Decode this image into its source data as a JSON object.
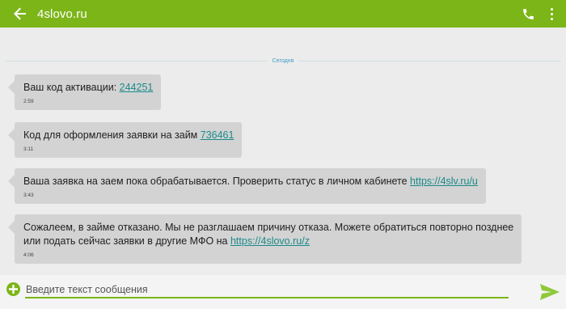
{
  "header": {
    "title": "4slovo.ru",
    "back_icon": "arrow-left-icon",
    "call_icon": "phone-icon",
    "menu_icon": "more-vertical-icon",
    "color": "#7cb518"
  },
  "date_separator": "Сегодня",
  "messages": [
    {
      "text": "Ваш код активации: ",
      "link": "244251",
      "text_after": "",
      "time": "2:59"
    },
    {
      "text": "Код для оформления заявки на займ ",
      "link": "736461",
      "text_after": "",
      "time": "3:11"
    },
    {
      "text": "Ваша заявка на заем пока обрабатывается. Проверить статус в личном кабинете ",
      "link": "https://4slv.ru/u",
      "text_after": "",
      "time": "3:43"
    },
    {
      "text_line1": "Сожалеем, в займе отказано. Мы не разглашаем причину отказа. Можете обратиться повторно позднее",
      "text": "или подать сейчас заявки в другие МФО на ",
      "link": "https://4slovo.ru/z",
      "text_after": "",
      "time": "4:06"
    }
  ],
  "composer": {
    "placeholder": "Введите текст сообщения",
    "value": "",
    "add_icon": "plus-circle-icon",
    "send_icon": "send-icon"
  },
  "colors": {
    "accent": "#7cb518",
    "bubble": "#d3d3d3",
    "link": "#1b8a8a",
    "background": "#ececec"
  }
}
